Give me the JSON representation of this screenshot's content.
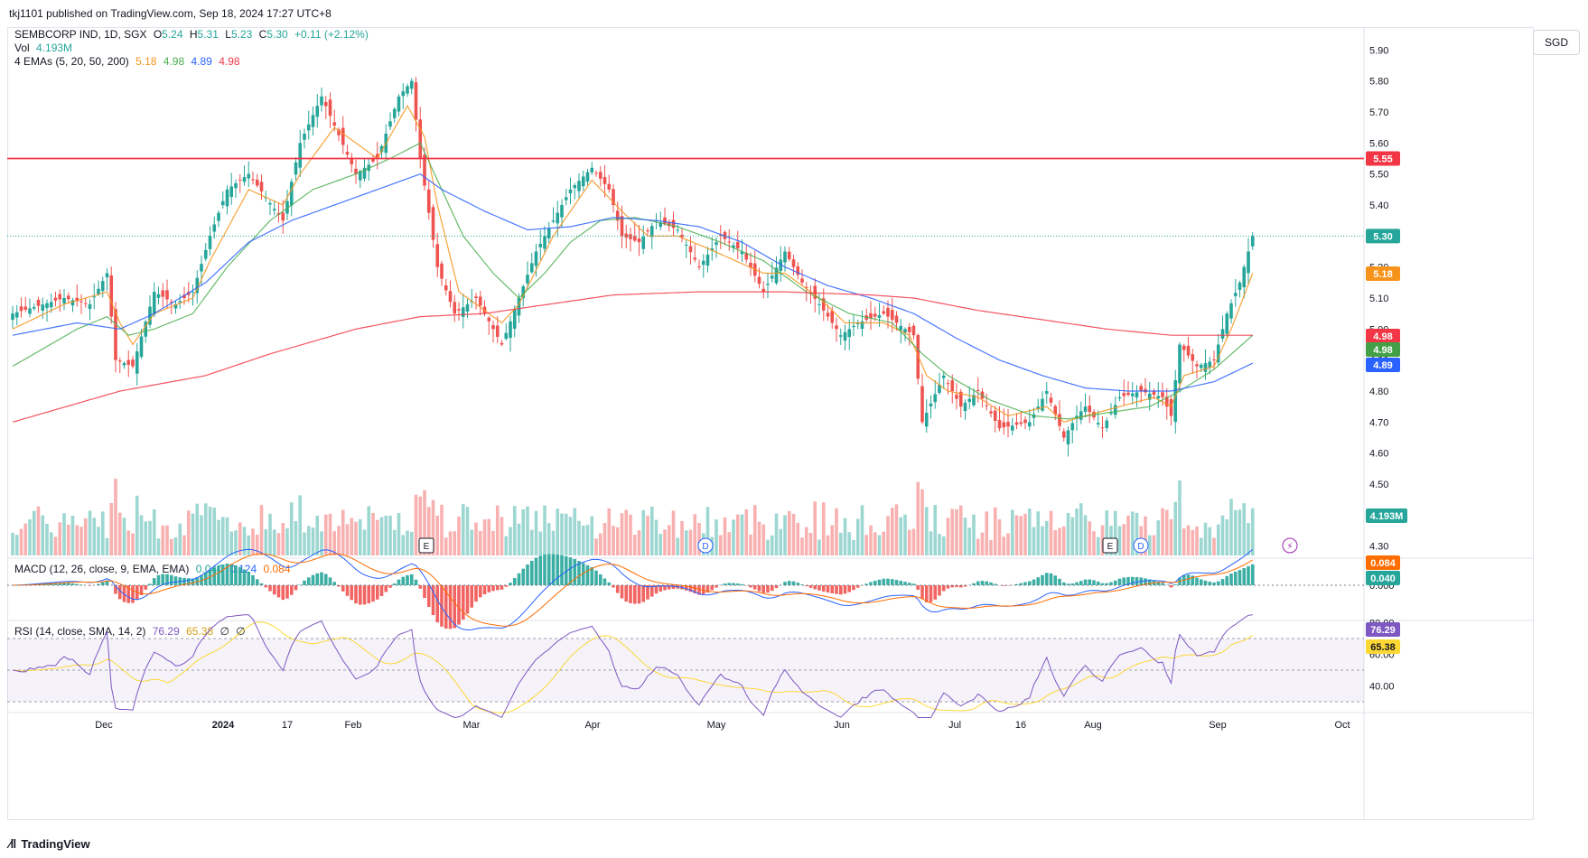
{
  "header": {
    "published": "tkj1101 published on TradingView.com, Sep 18, 2024 17:27 UTC+8"
  },
  "symbol": {
    "name": "SEMBCORP IND, 1D, SGX",
    "open_label": "O",
    "open": "5.24",
    "high_label": "H",
    "high": "5.31",
    "low_label": "L",
    "low": "5.23",
    "close_label": "C",
    "close": "5.30",
    "change": "+0.11 (+2.12%)"
  },
  "volume_legend": {
    "label": "Vol",
    "value": "4.193M"
  },
  "ema_legend": {
    "label": "4 EMAs (5, 20, 50, 200)",
    "values": [
      "5.18",
      "4.98",
      "4.89",
      "4.98"
    ]
  },
  "macd_legend": {
    "label": "MACD (12, 26, close, 9, EMA, EMA)",
    "values": [
      "0.040",
      "0.124",
      "0.084"
    ]
  },
  "rsi_legend": {
    "label": "RSI (14, close, SMA, 14, 2)",
    "values": [
      "76.29",
      "65.38"
    ],
    "extras": [
      "∅",
      "∅"
    ]
  },
  "currency_button": "SGD",
  "branding": "TradingView",
  "colors": {
    "up": "#26a69a",
    "down": "#ef5350",
    "ema5": "#f7931a",
    "ema20": "#4caf50",
    "ema50": "#2962ff",
    "ema200": "#f23645",
    "macd": "#2962ff",
    "signal": "#ff6d00",
    "rsi": "#7e57c2",
    "rsi_ma": "#fdd835",
    "resistance": "#f23645"
  },
  "chart_data": {
    "type": "candlestick",
    "price_axis_ticks": [
      "5.90",
      "5.80",
      "5.70",
      "5.60",
      "5.50",
      "5.40",
      "5.30",
      "5.20",
      "5.10",
      "5.00",
      "4.90",
      "4.80",
      "4.70",
      "4.60",
      "4.50",
      "4.40",
      "4.30"
    ],
    "price_range": [
      4.27,
      5.93
    ],
    "x_axis_labels": [
      "Dec",
      "2024",
      "17",
      "Feb",
      "Mar",
      "Apr",
      "May",
      "Jun",
      "Jul",
      "16",
      "Aug",
      "Sep",
      "Oct"
    ],
    "horizontal_line": {
      "value": 5.55,
      "label": "5.55"
    },
    "last_price": {
      "value": 5.3,
      "label": "5.30"
    },
    "price_tags": [
      {
        "label": "5.18",
        "series": "ema5"
      },
      {
        "label": "4.98",
        "series": "ema200"
      },
      {
        "label": "4.98",
        "series": "ema20"
      },
      {
        "label": "4.89",
        "series": "ema50"
      }
    ],
    "volume_tag": "4.193M",
    "event_markers": [
      {
        "label": "E",
        "kind": "earnings",
        "month": "Feb"
      },
      {
        "label": "D",
        "kind": "dividend",
        "month": "Apr"
      },
      {
        "label": "E",
        "kind": "earnings",
        "month": "Aug"
      },
      {
        "label": "D",
        "kind": "dividend",
        "month": "Aug"
      },
      {
        "label": "⚡",
        "kind": "split",
        "month": "Sep"
      }
    ],
    "macd": {
      "ticks": [
        "0.000"
      ],
      "tags": [
        {
          "label": "0.084",
          "series": "signal"
        },
        {
          "label": "0.040",
          "series": "histogram"
        }
      ]
    },
    "rsi": {
      "ticks": [
        "80.00",
        "60.00",
        "40.00"
      ],
      "band": [
        30,
        70
      ],
      "tags": [
        {
          "label": "76.29",
          "series": "rsi"
        },
        {
          "label": "65.38",
          "series": "rsi_ma"
        }
      ]
    },
    "series": [
      {
        "name": "close",
        "anchors": [
          [
            0,
            5.05
          ],
          [
            12,
            5.1
          ],
          [
            18,
            5.08
          ],
          [
            22,
            5.18
          ],
          [
            24,
            4.9
          ],
          [
            28,
            4.88
          ],
          [
            33,
            5.12
          ],
          [
            38,
            5.08
          ],
          [
            42,
            5.12
          ],
          [
            46,
            5.3
          ],
          [
            50,
            5.45
          ],
          [
            55,
            5.5
          ],
          [
            63,
            5.35
          ],
          [
            67,
            5.6
          ],
          [
            72,
            5.75
          ],
          [
            80,
            5.5
          ],
          [
            85,
            5.55
          ],
          [
            90,
            5.75
          ],
          [
            93,
            5.8
          ],
          [
            95,
            5.55
          ],
          [
            99,
            5.2
          ],
          [
            103,
            5.05
          ],
          [
            108,
            5.1
          ],
          [
            114,
            4.95
          ],
          [
            118,
            5.1
          ],
          [
            122,
            5.25
          ],
          [
            126,
            5.35
          ],
          [
            130,
            5.45
          ],
          [
            135,
            5.52
          ],
          [
            139,
            5.45
          ],
          [
            142,
            5.3
          ],
          [
            146,
            5.28
          ],
          [
            150,
            5.35
          ],
          [
            155,
            5.32
          ],
          [
            160,
            5.2
          ],
          [
            165,
            5.3
          ],
          [
            170,
            5.25
          ],
          [
            175,
            5.12
          ],
          [
            180,
            5.25
          ],
          [
            184,
            5.15
          ],
          [
            188,
            5.08
          ],
          [
            193,
            4.98
          ],
          [
            197,
            5.02
          ],
          [
            203,
            5.05
          ],
          [
            210,
            4.98
          ],
          [
            212,
            4.7
          ],
          [
            217,
            4.85
          ],
          [
            221,
            4.75
          ],
          [
            225,
            4.8
          ],
          [
            230,
            4.68
          ],
          [
            237,
            4.7
          ],
          [
            241,
            4.8
          ],
          [
            245,
            4.65
          ],
          [
            248,
            4.72
          ],
          [
            250,
            4.75
          ],
          [
            254,
            4.68
          ],
          [
            258,
            4.78
          ],
          [
            263,
            4.8
          ],
          [
            268,
            4.78
          ],
          [
            270,
            4.72
          ],
          [
            272,
            4.95
          ],
          [
            276,
            4.88
          ],
          [
            280,
            4.9
          ],
          [
            283,
            5.05
          ],
          [
            286,
            5.15
          ],
          [
            289,
            5.3
          ]
        ]
      },
      {
        "name": "ema5",
        "anchors": [
          [
            0,
            5.0
          ],
          [
            12,
            5.08
          ],
          [
            22,
            5.12
          ],
          [
            25,
            5.02
          ],
          [
            28,
            4.95
          ],
          [
            33,
            5.05
          ],
          [
            42,
            5.1
          ],
          [
            46,
            5.22
          ],
          [
            55,
            5.45
          ],
          [
            63,
            5.4
          ],
          [
            67,
            5.5
          ],
          [
            75,
            5.65
          ],
          [
            85,
            5.55
          ],
          [
            92,
            5.72
          ],
          [
            96,
            5.62
          ],
          [
            99,
            5.4
          ],
          [
            104,
            5.12
          ],
          [
            114,
            5.02
          ],
          [
            118,
            5.08
          ],
          [
            126,
            5.3
          ],
          [
            135,
            5.48
          ],
          [
            142,
            5.38
          ],
          [
            148,
            5.3
          ],
          [
            155,
            5.3
          ],
          [
            162,
            5.26
          ],
          [
            175,
            5.18
          ],
          [
            180,
            5.18
          ],
          [
            188,
            5.1
          ],
          [
            194,
            5.02
          ],
          [
            203,
            5.02
          ],
          [
            209,
            4.98
          ],
          [
            213,
            4.85
          ],
          [
            218,
            4.8
          ],
          [
            225,
            4.78
          ],
          [
            232,
            4.72
          ],
          [
            241,
            4.75
          ],
          [
            245,
            4.7
          ],
          [
            250,
            4.72
          ],
          [
            258,
            4.75
          ],
          [
            266,
            4.78
          ],
          [
            270,
            4.75
          ],
          [
            273,
            4.85
          ],
          [
            280,
            4.88
          ],
          [
            284,
            5.0
          ],
          [
            289,
            5.18
          ]
        ]
      },
      {
        "name": "ema20",
        "anchors": [
          [
            0,
            4.88
          ],
          [
            15,
            5.0
          ],
          [
            22,
            5.04
          ],
          [
            27,
            4.98
          ],
          [
            33,
            5.0
          ],
          [
            42,
            5.05
          ],
          [
            50,
            5.2
          ],
          [
            60,
            5.35
          ],
          [
            70,
            5.45
          ],
          [
            80,
            5.5
          ],
          [
            88,
            5.55
          ],
          [
            95,
            5.6
          ],
          [
            99,
            5.48
          ],
          [
            105,
            5.3
          ],
          [
            112,
            5.18
          ],
          [
            118,
            5.1
          ],
          [
            124,
            5.18
          ],
          [
            130,
            5.28
          ],
          [
            137,
            5.35
          ],
          [
            145,
            5.36
          ],
          [
            155,
            5.33
          ],
          [
            165,
            5.28
          ],
          [
            175,
            5.22
          ],
          [
            185,
            5.12
          ],
          [
            195,
            5.05
          ],
          [
            205,
            5.02
          ],
          [
            212,
            4.92
          ],
          [
            218,
            4.85
          ],
          [
            228,
            4.77
          ],
          [
            238,
            4.72
          ],
          [
            246,
            4.71
          ],
          [
            255,
            4.73
          ],
          [
            265,
            4.75
          ],
          [
            272,
            4.8
          ],
          [
            280,
            4.87
          ],
          [
            289,
            4.98
          ]
        ]
      },
      {
        "name": "ema50",
        "anchors": [
          [
            0,
            4.98
          ],
          [
            15,
            5.02
          ],
          [
            25,
            5.0
          ],
          [
            33,
            5.05
          ],
          [
            45,
            5.15
          ],
          [
            55,
            5.28
          ],
          [
            65,
            5.35
          ],
          [
            75,
            5.4
          ],
          [
            85,
            5.45
          ],
          [
            95,
            5.5
          ],
          [
            100,
            5.45
          ],
          [
            110,
            5.38
          ],
          [
            120,
            5.32
          ],
          [
            130,
            5.33
          ],
          [
            140,
            5.36
          ],
          [
            150,
            5.35
          ],
          [
            160,
            5.33
          ],
          [
            170,
            5.28
          ],
          [
            180,
            5.2
          ],
          [
            190,
            5.14
          ],
          [
            200,
            5.1
          ],
          [
            210,
            5.05
          ],
          [
            220,
            4.97
          ],
          [
            230,
            4.9
          ],
          [
            240,
            4.85
          ],
          [
            250,
            4.81
          ],
          [
            260,
            4.8
          ],
          [
            270,
            4.8
          ],
          [
            280,
            4.83
          ],
          [
            289,
            4.89
          ]
        ]
      },
      {
        "name": "ema200",
        "anchors": [
          [
            0,
            4.7
          ],
          [
            25,
            4.8
          ],
          [
            45,
            4.85
          ],
          [
            60,
            4.92
          ],
          [
            80,
            5.0
          ],
          [
            95,
            5.04
          ],
          [
            110,
            5.05
          ],
          [
            125,
            5.08
          ],
          [
            140,
            5.11
          ],
          [
            160,
            5.12
          ],
          [
            180,
            5.12
          ],
          [
            200,
            5.11
          ],
          [
            210,
            5.1
          ],
          [
            225,
            5.06
          ],
          [
            240,
            5.03
          ],
          [
            255,
            5.0
          ],
          [
            270,
            4.98
          ],
          [
            289,
            4.98
          ]
        ]
      }
    ]
  }
}
